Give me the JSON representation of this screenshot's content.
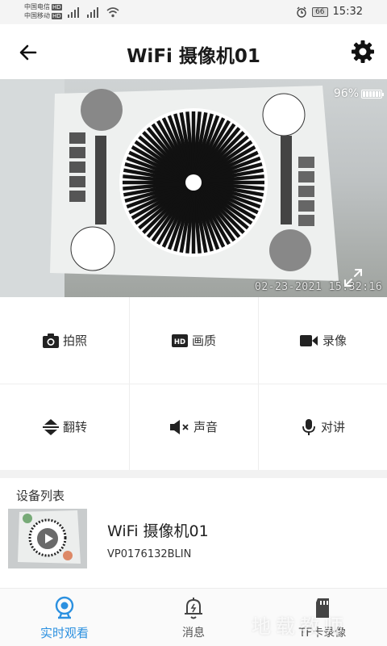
{
  "status_bar": {
    "carrier_1": "中国电信",
    "carrier_2": "中国移动",
    "hd_label": "HD",
    "battery": "66",
    "time": "15:32"
  },
  "header": {
    "title": "WiFi 摄像机01"
  },
  "video": {
    "battery_level": "96%",
    "timestamp": "02-23-2021  15:32:16"
  },
  "controls": [
    {
      "label": "拍照",
      "icon": "camera-icon"
    },
    {
      "label": "画质",
      "icon": "hd-icon"
    },
    {
      "label": "录像",
      "icon": "video-record-icon"
    },
    {
      "label": "翻转",
      "icon": "flip-icon"
    },
    {
      "label": "声音",
      "icon": "mute-icon"
    },
    {
      "label": "对讲",
      "icon": "microphone-icon"
    }
  ],
  "device_list": {
    "title": "设备列表",
    "devices": [
      {
        "name": "WiFi 摄像机01",
        "id": "VP0176132BLIN"
      }
    ]
  },
  "bottom_nav": {
    "tabs": [
      {
        "label": "实时观看",
        "icon": "webcam-icon",
        "active": true
      },
      {
        "label": "消息",
        "icon": "bell-icon",
        "active": false
      },
      {
        "label": "TF卡录像",
        "icon": "sd-card-icon",
        "active": false
      }
    ]
  },
  "colors": {
    "accent": "#2b90e0"
  }
}
